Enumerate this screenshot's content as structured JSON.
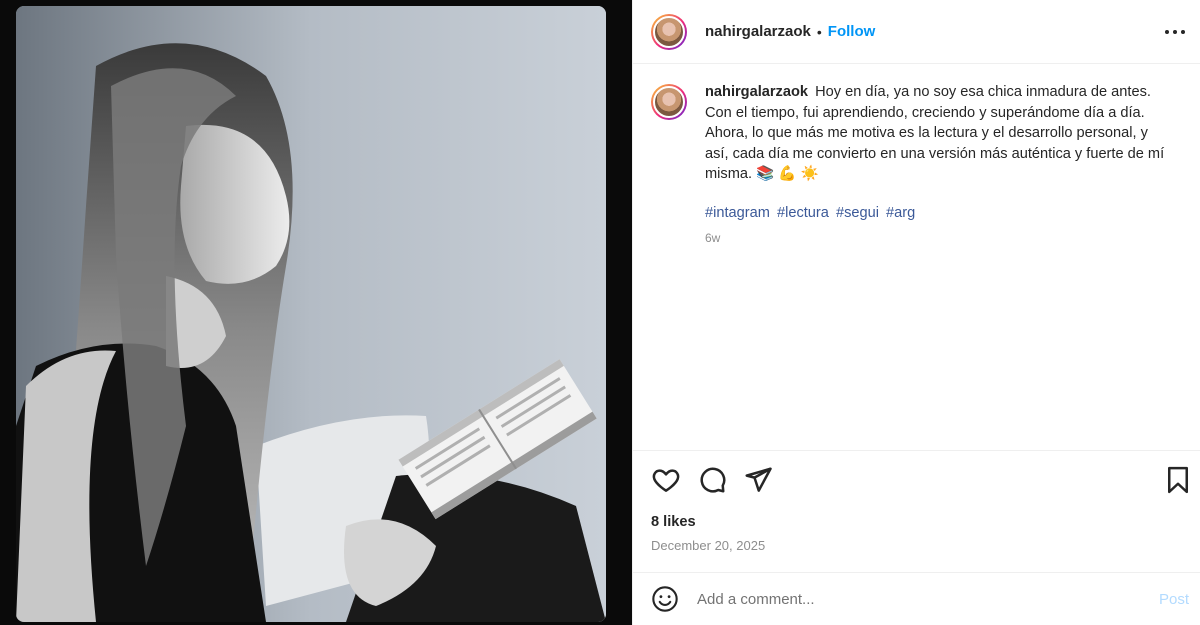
{
  "post": {
    "username": "nahirgalarzaok",
    "separator": "•",
    "follow_label": "Follow",
    "more_icon": "more-horizontal-icon"
  },
  "caption": {
    "username": "nahirgalarzaok",
    "text": "Hoy en día, ya no soy esa chica inmadura de antes. Con el tiempo, fui aprendiendo, creciendo y superándome día a día. Ahora, lo que más me motiva es la lectura y el desarrollo personal, y así, cada día me convierto en una versión más auténtica y fuerte de mí misma. 📚 💪 ☀️",
    "hashtags": [
      "#intagram",
      "#lectura",
      "#segui",
      "#arg"
    ],
    "time_ago": "6w"
  },
  "actions": {
    "like_icon": "heart-icon",
    "comment_icon": "comment-bubble-icon",
    "share_icon": "paper-plane-icon",
    "save_icon": "bookmark-icon"
  },
  "stats": {
    "likes": "8 likes",
    "date": "December 20, 2025"
  },
  "comment": {
    "emoji_icon": "smiley-icon",
    "placeholder": "Add a comment...",
    "post_label": "Post"
  },
  "colors": {
    "accent": "#0095f6",
    "post_disabled": "#b3dbff",
    "hashtag": "#3b5998",
    "muted": "#8e8e8e"
  }
}
